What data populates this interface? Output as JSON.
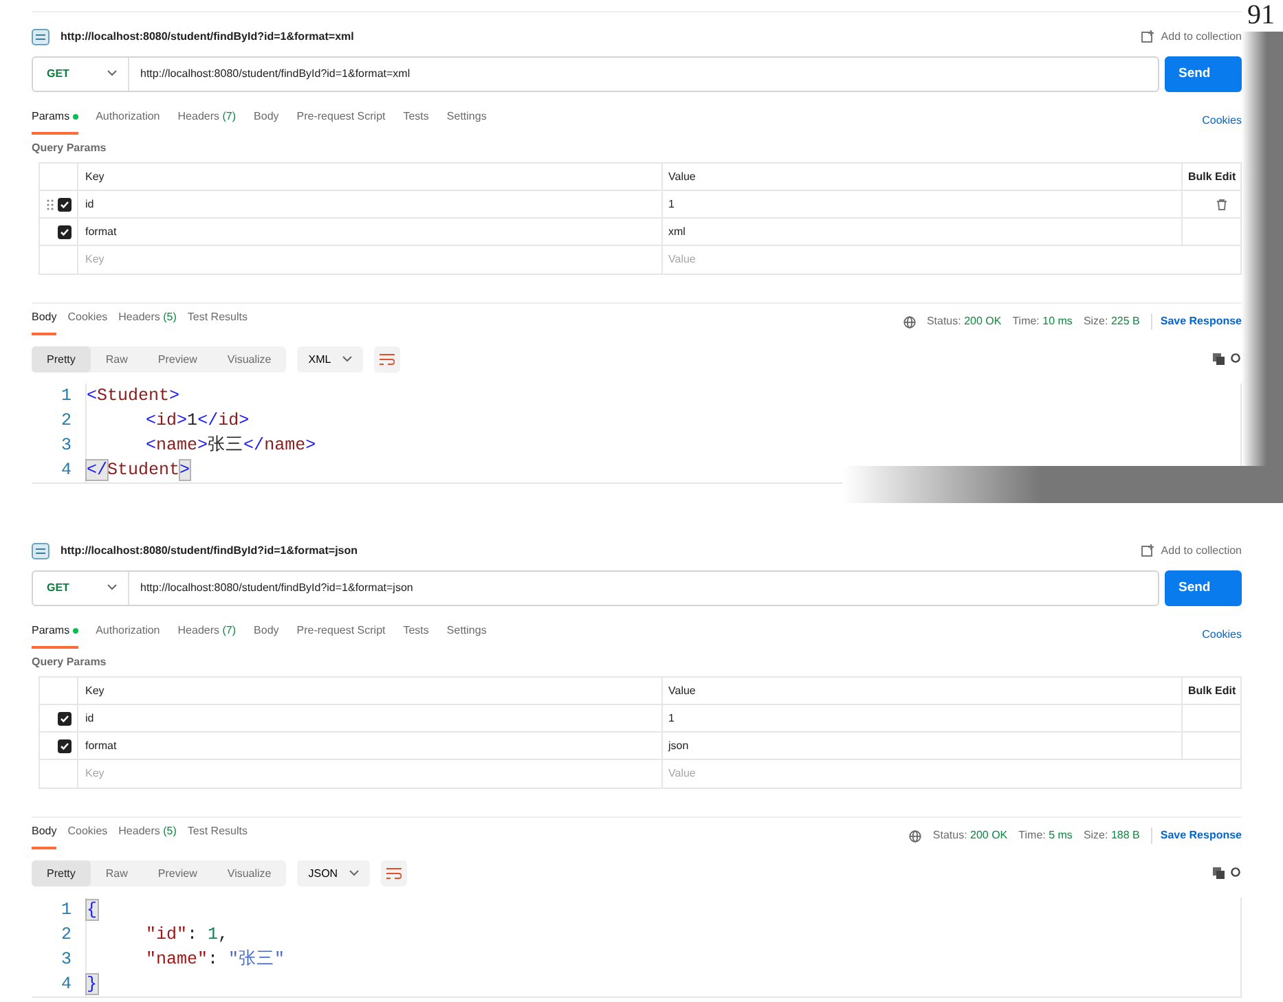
{
  "page_number": "91",
  "panels": [
    {
      "title": "http://localhost:8080/student/findById?id=1&format=xml",
      "add_to_collection": "Add to collection",
      "method": "GET",
      "url": "http://localhost:8080/student/findById?id=1&format=xml",
      "send": "Send",
      "request_tabs": [
        {
          "label": "Params",
          "selected": true,
          "dot": true
        },
        {
          "label": "Authorization",
          "selected": false
        },
        {
          "label": "Headers",
          "count": "(7)",
          "selected": false
        },
        {
          "label": "Body",
          "selected": false
        },
        {
          "label": "Pre-request Script",
          "selected": false
        },
        {
          "label": "Tests",
          "selected": false
        },
        {
          "label": "Settings",
          "selected": false
        }
      ],
      "cookies": "Cookies",
      "query_params": "Query Params",
      "columns": [
        "Key",
        "Value",
        "Bulk Edit"
      ],
      "params": [
        {
          "key": "id",
          "value": "1",
          "checked": true,
          "hovered": true
        },
        {
          "key": "format",
          "value": "xml",
          "checked": true,
          "hovered": false
        }
      ],
      "empty_row": {
        "key_placeholder": "Key",
        "value_placeholder": "Value"
      },
      "response_tabs": [
        {
          "label": "Body",
          "selected": true
        },
        {
          "label": "Cookies",
          "selected": false
        },
        {
          "label": "Headers",
          "count": "(5)",
          "selected": false
        },
        {
          "label": "Test Results",
          "selected": false
        }
      ],
      "status_label": "Status:",
      "status": "200 OK",
      "time_label": "Time:",
      "time": "10 ms",
      "size_label": "Size:",
      "size": "225 B",
      "save_response": "Save Response",
      "view_modes": [
        {
          "label": "Pretty",
          "selected": true
        },
        {
          "label": "Raw",
          "selected": false
        },
        {
          "label": "Preview",
          "selected": false
        },
        {
          "label": "Visualize",
          "selected": false
        }
      ],
      "format": "XML",
      "code": [
        {
          "number": "1",
          "indented": false,
          "tokens": [
            {
              "text": "<",
              "kind": "punct"
            },
            {
              "text": "Student",
              "kind": "tag"
            },
            {
              "text": ">",
              "kind": "punct"
            }
          ]
        },
        {
          "number": "2",
          "indented": true,
          "tokens": [
            {
              "text": "<",
              "kind": "punct"
            },
            {
              "text": "id",
              "kind": "tag"
            },
            {
              "text": ">",
              "kind": "punct"
            },
            {
              "text": "1",
              "kind": "text"
            },
            {
              "text": "</",
              "kind": "punct"
            },
            {
              "text": "id",
              "kind": "tag"
            },
            {
              "text": ">",
              "kind": "punct"
            }
          ]
        },
        {
          "number": "3",
          "indented": true,
          "tokens": [
            {
              "text": "<",
              "kind": "punct"
            },
            {
              "text": "name",
              "kind": "tag"
            },
            {
              "text": ">",
              "kind": "punct"
            },
            {
              "text": "张三",
              "kind": "text"
            },
            {
              "text": "</",
              "kind": "punct"
            },
            {
              "text": "name",
              "kind": "tag"
            },
            {
              "text": ">",
              "kind": "punct"
            }
          ]
        },
        {
          "number": "4",
          "indented": false,
          "tokens": [
            {
              "text": "</",
              "kind": "match"
            },
            {
              "text": "Student",
              "kind": "tag"
            },
            {
              "text": ">",
              "kind": "match"
            }
          ]
        }
      ],
      "shadow": true
    },
    {
      "title": "http://localhost:8080/student/findById?id=1&format=json",
      "add_to_collection": "Add to collection",
      "method": "GET",
      "url": "http://localhost:8080/student/findById?id=1&format=json",
      "send": "Send",
      "request_tabs": [
        {
          "label": "Params",
          "selected": true,
          "dot": true
        },
        {
          "label": "Authorization",
          "selected": false
        },
        {
          "label": "Headers",
          "count": "(7)",
          "selected": false
        },
        {
          "label": "Body",
          "selected": false
        },
        {
          "label": "Pre-request Script",
          "selected": false
        },
        {
          "label": "Tests",
          "selected": false
        },
        {
          "label": "Settings",
          "selected": false
        }
      ],
      "cookies": "Cookies",
      "query_params": "Query Params",
      "columns": [
        "Key",
        "Value",
        "Bulk Edit"
      ],
      "params": [
        {
          "key": "id",
          "value": "1",
          "checked": true,
          "hovered": false
        },
        {
          "key": "format",
          "value": "json",
          "checked": true,
          "hovered": false
        }
      ],
      "empty_row": {
        "key_placeholder": "Key",
        "value_placeholder": "Value"
      },
      "response_tabs": [
        {
          "label": "Body",
          "selected": true
        },
        {
          "label": "Cookies",
          "selected": false
        },
        {
          "label": "Headers",
          "count": "(5)",
          "selected": false
        },
        {
          "label": "Test Results",
          "selected": false
        }
      ],
      "status_label": "Status:",
      "status": "200 OK",
      "time_label": "Time:",
      "time": "5 ms",
      "size_label": "Size:",
      "size": "188 B",
      "save_response": "Save Response",
      "view_modes": [
        {
          "label": "Pretty",
          "selected": true
        },
        {
          "label": "Raw",
          "selected": false
        },
        {
          "label": "Preview",
          "selected": false
        },
        {
          "label": "Visualize",
          "selected": false
        }
      ],
      "format": "JSON",
      "code": [
        {
          "number": "1",
          "indented": false,
          "tokens": [
            {
              "text": "{",
              "kind": "match"
            }
          ]
        },
        {
          "number": "2",
          "indented": true,
          "tokens": [
            {
              "text": "\"id\"",
              "kind": "key"
            },
            {
              "text": ": ",
              "kind": "text"
            },
            {
              "text": "1",
              "kind": "number"
            },
            {
              "text": ",",
              "kind": "text"
            }
          ]
        },
        {
          "number": "3",
          "indented": true,
          "tokens": [
            {
              "text": "\"name\"",
              "kind": "key"
            },
            {
              "text": ": ",
              "kind": "text"
            },
            {
              "text": "\"张三\"",
              "kind": "string"
            }
          ]
        },
        {
          "number": "4",
          "indented": false,
          "tokens": [
            {
              "text": "}",
              "kind": "match"
            }
          ]
        }
      ],
      "shadow": false
    }
  ]
}
